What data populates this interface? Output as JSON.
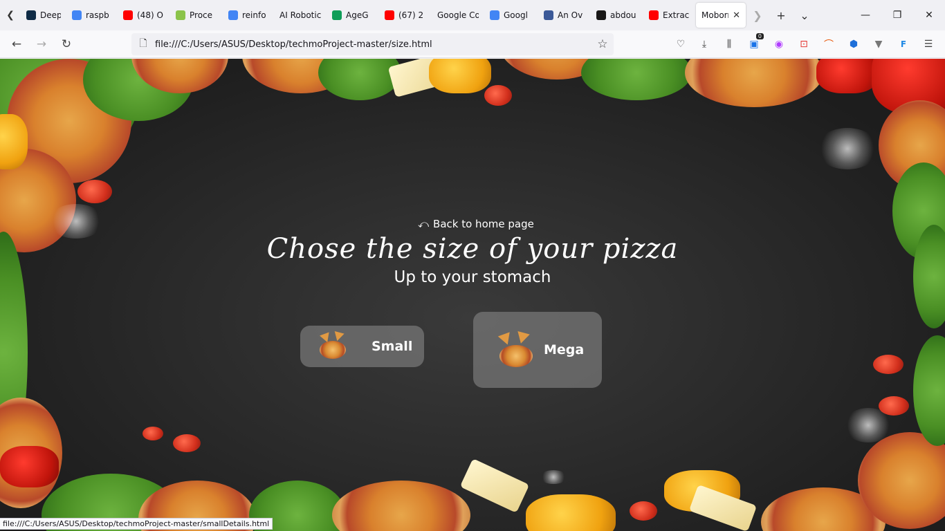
{
  "browser": {
    "tabs": [
      {
        "title": "Deep l",
        "icon": "deepl-icon",
        "color": "#0f2b46"
      },
      {
        "title": "raspb",
        "icon": "google-icon",
        "color": "#4285f4"
      },
      {
        "title": "(48) O",
        "icon": "youtube-icon",
        "color": "#ff0000"
      },
      {
        "title": "Proce",
        "icon": "smiley-icon",
        "color": "#8bc34a"
      },
      {
        "title": "reinfo",
        "icon": "google-icon",
        "color": "#4285f4"
      },
      {
        "title": "AI Robotic",
        "icon": "",
        "color": ""
      },
      {
        "title": "AgeG",
        "icon": "drive-icon",
        "color": "#0f9d58"
      },
      {
        "title": "(67) 2",
        "icon": "youtube-icon",
        "color": "#ff0000"
      },
      {
        "title": "Google Co",
        "icon": "",
        "color": ""
      },
      {
        "title": "Googl",
        "icon": "translate-icon",
        "color": "#4285f4"
      },
      {
        "title": "An Ov",
        "icon": "arxiv-icon",
        "color": "#3b5998"
      },
      {
        "title": "abdou",
        "icon": "github-icon",
        "color": "#181717"
      },
      {
        "title": "Extrac",
        "icon": "youtube-icon",
        "color": "#ff0000"
      },
      {
        "title": "Moborn",
        "icon": "",
        "color": "",
        "active": true
      }
    ],
    "address": "file:///C:/Users/ASUS/Desktop/techmoProject-master/size.html",
    "extension_badge": "0",
    "status_url": "file:///C:/Users/ASUS/Desktop/techmoProject-master/smallDetails.html"
  },
  "page": {
    "back_link": "Back to home page",
    "title": "Chose the size of your pizza",
    "subtitle": "Up to your stomach",
    "buttons": {
      "small": "Small",
      "mega": "Mega"
    }
  }
}
